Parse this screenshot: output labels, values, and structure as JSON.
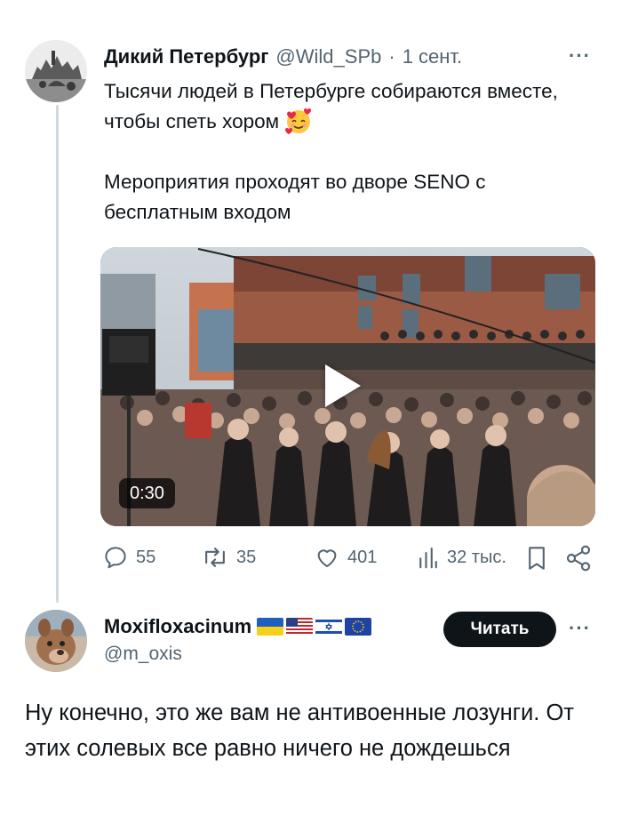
{
  "tweet1": {
    "author_name": "Дикий Петербург",
    "handle": "@Wild_SPb",
    "separator": "·",
    "date": "1 сент.",
    "more_icon": "more-horizontal-icon",
    "text_line1": "Тысячи людей в Петербурге собираются вместе, чтобы спеть хором",
    "text_line2": "Мероприятия проходят во дворе SENO с бесплатным входом",
    "video": {
      "duration": "0:30",
      "play_icon": "play-icon"
    },
    "actions": {
      "replies": "55",
      "retweets": "35",
      "likes": "401",
      "views": "32 тыс."
    }
  },
  "tweet2": {
    "author_name": "Moxifloxacinum",
    "flags": [
      "ukraine-flag",
      "usa-flag",
      "israel-flag",
      "eu-flag"
    ],
    "handle": "@m_oxis",
    "follow_label": "Читать",
    "text": "Ну конечно, это же вам не антивоенные лозунги. От этих солевых все равно ничего не дождешься"
  },
  "colors": {
    "text_primary": "#0f1419",
    "text_secondary": "#536471",
    "thread_line": "#cfd9de",
    "follow_bg": "#0f1419"
  }
}
